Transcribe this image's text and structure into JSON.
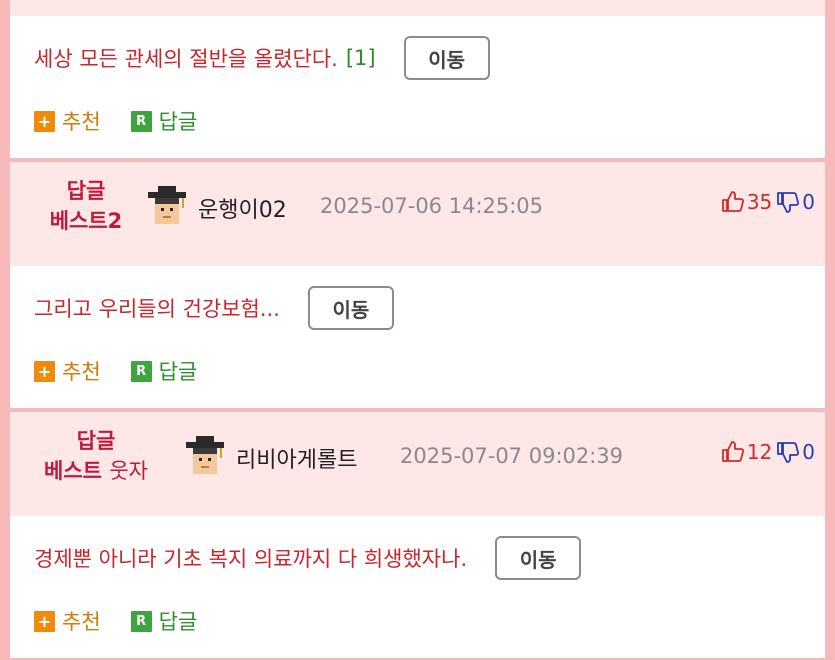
{
  "comments": [
    {
      "text": "세상 모든 관세의 절반을 올렸단다.",
      "reply_count": "[1]",
      "move_label": "이동",
      "recommend_label": "추천",
      "reply_label": "답글"
    },
    {
      "badge_line1": "답글",
      "badge_line2": "베스트2",
      "badge_sub": "",
      "user": "운행이02",
      "time": "2025-07-06 14:25:05",
      "up": "35",
      "down": "0",
      "text": "그리고 우리들의 건강보험...",
      "move_label": "이동",
      "recommend_label": "추천",
      "reply_label": "답글"
    },
    {
      "badge_line1": "답글",
      "badge_line2": "베스트",
      "badge_sub": "웃자",
      "user": "리비아게롤트",
      "time": "2025-07-07 09:02:39",
      "up": "12",
      "down": "0",
      "text": "경제뿐 아니라 기초 복지 의료까지 다 희생했자나.",
      "move_label": "이동",
      "recommend_label": "추천",
      "reply_label": "답글"
    }
  ],
  "icons": {
    "recommend": "plus-icon",
    "reply": "reply-r-icon",
    "up": "thumbs-up-icon",
    "down": "thumbs-down-icon",
    "avatar": "graduate-avatar-icon"
  },
  "colors": {
    "comment_text": "#c8262a",
    "badge": "#c0183f",
    "header_bg": "#fde7e7",
    "border": "#f7b9b9"
  }
}
